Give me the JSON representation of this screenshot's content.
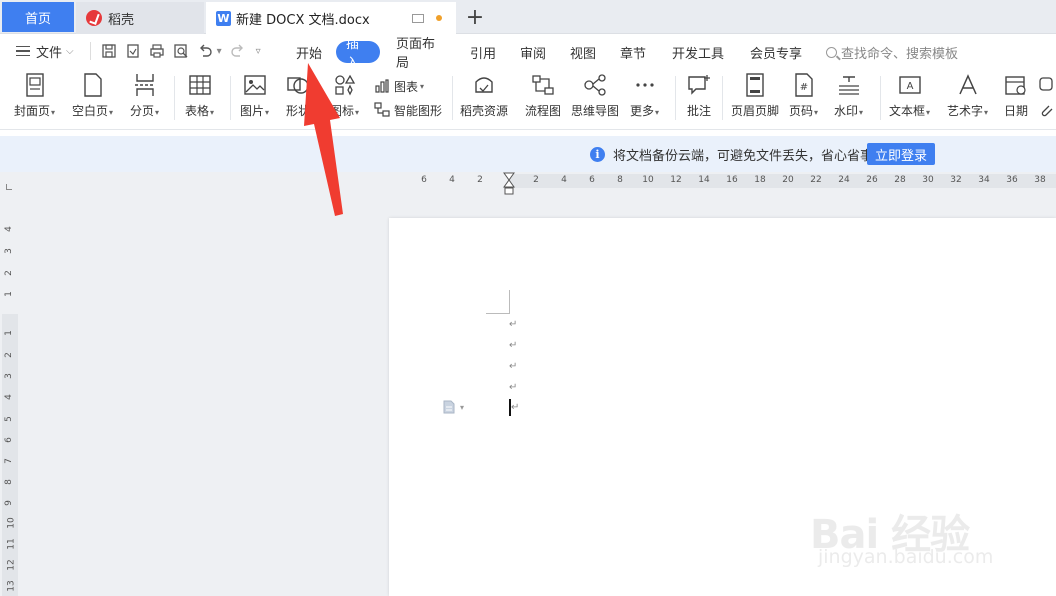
{
  "tabs": {
    "home": "首页",
    "daoke": "稻壳",
    "document": "新建 DOCX 文档.docx",
    "add": "+"
  },
  "menu": {
    "file": "文件",
    "tabs": [
      "开始",
      "插入",
      "页面布局",
      "引用",
      "审阅",
      "视图",
      "章节",
      "开发工具",
      "会员专享"
    ],
    "active_tab": "插入",
    "search_placeholder": "查找命令、搜索模板"
  },
  "ribbon": {
    "cover": "封面页",
    "blank": "空白页",
    "break": "分页",
    "table": "表格",
    "picture": "图片",
    "shape": "形状",
    "icon": "图标",
    "chart": "图表",
    "smart_art": "智能图形",
    "daoke_res": "稻壳资源",
    "flowchart": "流程图",
    "mindmap": "思维导图",
    "more": "更多",
    "comment": "批注",
    "header_footer": "页眉页脚",
    "page_num": "页码",
    "watermark": "水印",
    "textbox": "文本框",
    "wordart": "艺术字",
    "date": "日期"
  },
  "notice": {
    "message": "将文档备份云端，可避免文件丢失，省心省事",
    "button": "立即登录"
  },
  "ruler": {
    "h_ticks": [
      "6",
      "4",
      "2",
      "2",
      "4",
      "6",
      "8",
      "10",
      "12",
      "14",
      "16",
      "18",
      "20",
      "22",
      "24",
      "26",
      "28",
      "30",
      "32",
      "34",
      "36",
      "38"
    ],
    "v_ticks_top": [
      "4",
      "3",
      "2",
      "1"
    ],
    "v_ticks_body": [
      "1",
      "2",
      "3",
      "4",
      "5",
      "6",
      "7",
      "8",
      "9",
      "10",
      "11",
      "12",
      "13"
    ]
  },
  "document": {
    "paragraph_mark": "↵"
  },
  "watermark_text": {
    "brand": "Bai 经验",
    "url": "jingyan.baidu.com"
  },
  "colors": {
    "accent": "#3f7ff0",
    "arrow": "#f03c30"
  }
}
